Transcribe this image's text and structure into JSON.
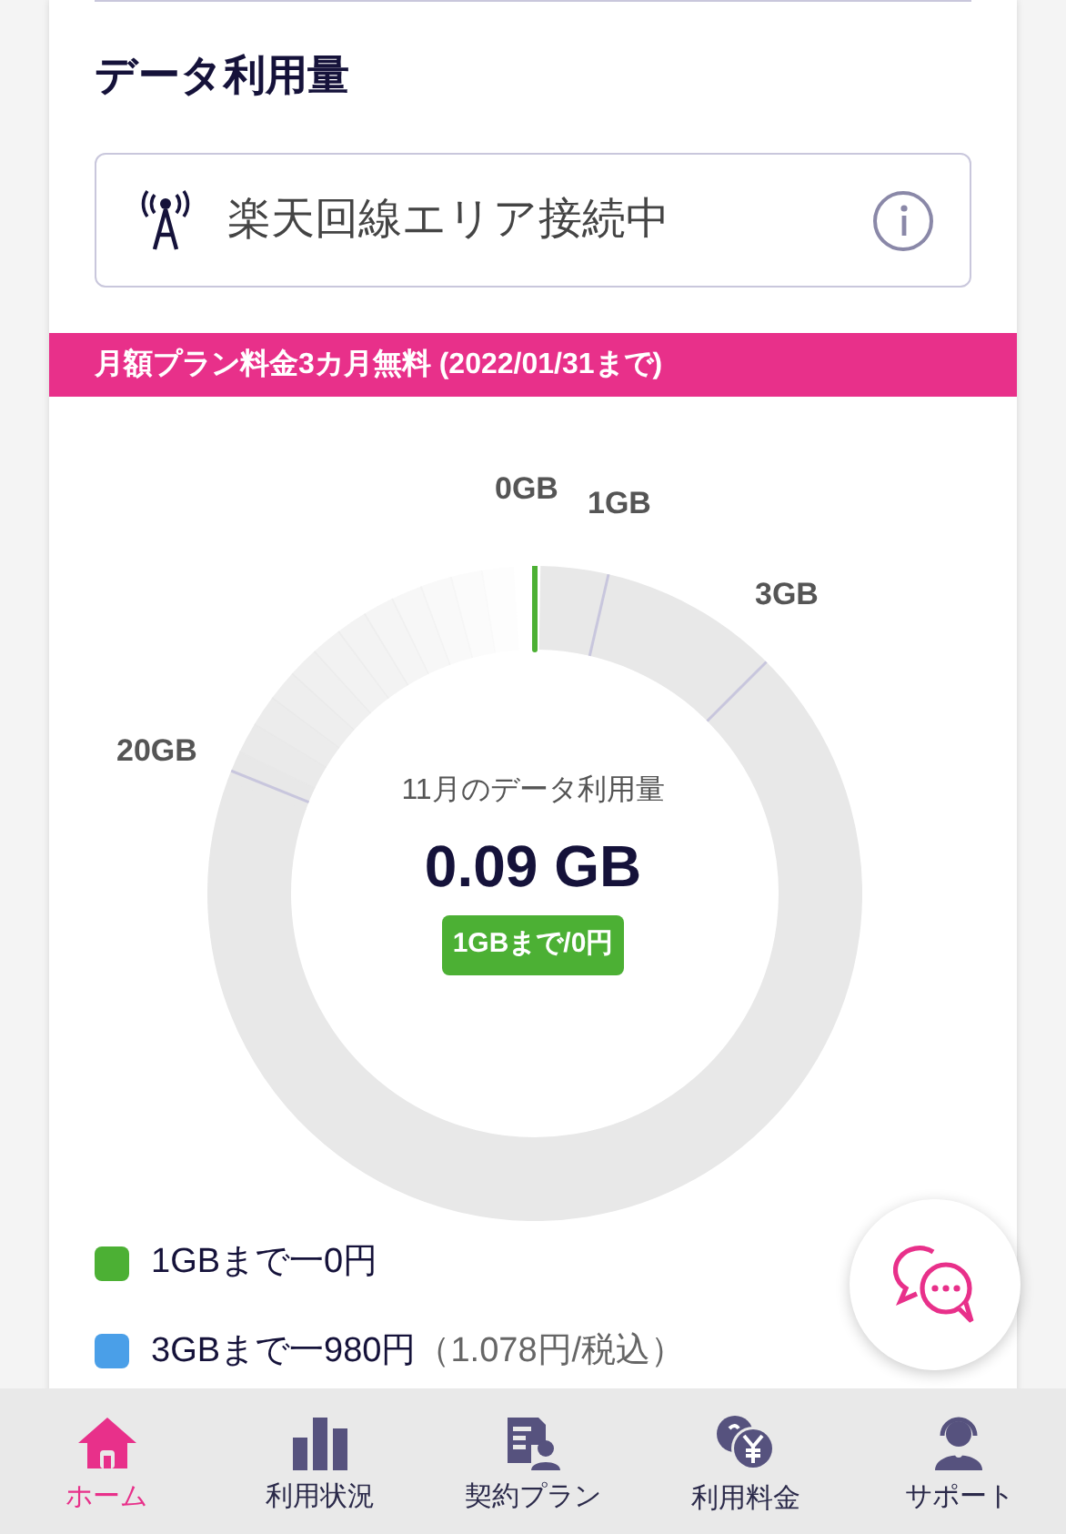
{
  "section_title": "データ利用量",
  "network_status": {
    "text": "楽天回線エリア接続中"
  },
  "promo_banner": "月額プラン料金3カ月無料 (2022/01/31まで)",
  "gauge": {
    "tick_labels": [
      "0GB",
      "1GB",
      "3GB",
      "20GB"
    ],
    "caption": "11月のデータ利用量",
    "usage": "0.09 GB",
    "tier_badge": "1GBまで/0円"
  },
  "legend": [
    {
      "label": "1GBまで一0円",
      "color": "#4cb034"
    },
    {
      "label": "3GBまで一980円",
      "note": "（1.078円/税込）",
      "color": "#4a9fe8"
    }
  ],
  "bottom_nav": [
    {
      "label": "ホーム",
      "kind": "home",
      "selected": true
    },
    {
      "label": "利用状況",
      "kind": "usage",
      "selected": false
    },
    {
      "label": "契約プラン",
      "kind": "plan",
      "selected": false
    },
    {
      "label": "利用料金",
      "kind": "fee",
      "selected": false
    },
    {
      "label": "サポート",
      "kind": "support",
      "selected": false
    }
  ]
}
